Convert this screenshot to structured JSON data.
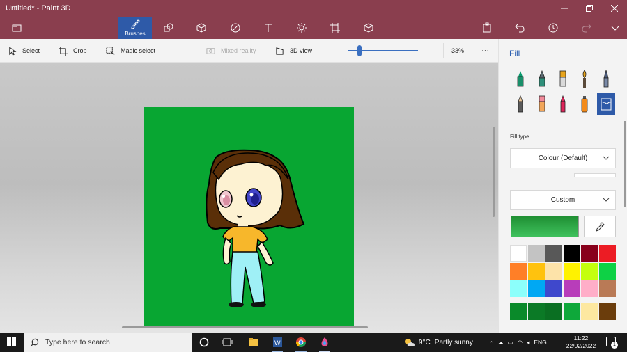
{
  "window": {
    "title": "Untitled* - Paint 3D",
    "minimize_icon": "minimize-icon",
    "restore_icon": "restore-icon",
    "close_icon": "close-icon"
  },
  "main_toolbar": {
    "brushes_label": "Brushes",
    "items": [
      "menu-folder-icon",
      "brushes-icon",
      "2d-shapes-icon",
      "3d-shapes-icon",
      "stickers-icon",
      "text-icon",
      "effects-icon",
      "canvas-icon",
      "3d-library-icon",
      "paste-icon",
      "undo-icon",
      "history-icon",
      "redo-icon",
      "expand-icon"
    ]
  },
  "sub_toolbar": {
    "select": "Select",
    "crop": "Crop",
    "magic_select": "Magic select",
    "mixed_reality": "Mixed reality",
    "view_3d": "3D view",
    "zoom_value": "33%",
    "zoom_level": 0.16,
    "more": "···"
  },
  "side_panel": {
    "title": "Fill",
    "fill_type_label": "Fill type",
    "fill_type_value": "Colour (Default)",
    "color_mode_value": "Custom",
    "current_color": "#1f9a3a",
    "tools": [
      "marker",
      "calligraphy-pen",
      "oil-brush",
      "watercolor",
      "pixel-pen",
      "pencil",
      "eraser",
      "crayon",
      "spray-can",
      "fill"
    ],
    "palette": [
      "#ffffff",
      "#c3c3c3",
      "#585858",
      "#000000",
      "#88001b",
      "#ec1c24",
      "#ff7f27",
      "#ffc20e",
      "#fde3a9",
      "#fff200",
      "#c4ff0e",
      "#0ed145",
      "#8cfffb",
      "#00a8f3",
      "#3f48cc",
      "#b83dba",
      "#ffaec8",
      "#b97a56",
      "#0a8a2a",
      "#0b7a26",
      "#0a6f22",
      "#0ea83a",
      "#fde8a0",
      "#6b3d0c"
    ]
  },
  "canvas": {
    "background": "#08a632"
  },
  "taskbar": {
    "search_placeholder": "Type here to search",
    "weather_temp": "9°C",
    "weather_text": "Partly sunny",
    "language": "ENG",
    "time": "11:22",
    "date": "22/02/2022",
    "notification_count": "1"
  }
}
